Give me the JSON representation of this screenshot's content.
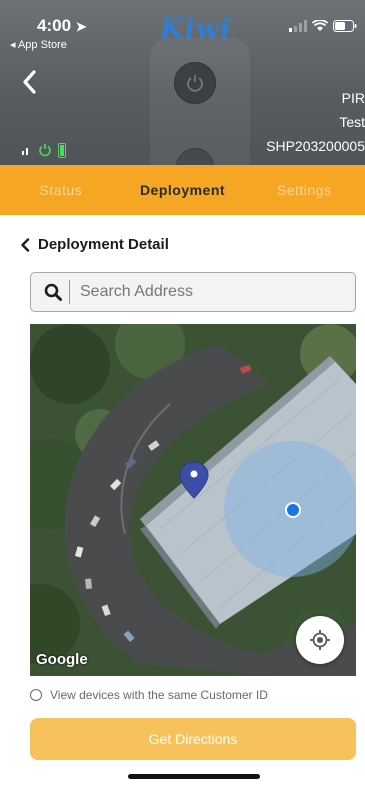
{
  "status_bar": {
    "time": "4:00",
    "back_app_label": "◂ App Store",
    "icons": [
      "cellular-signal-icon",
      "wifi-icon",
      "battery-icon"
    ]
  },
  "header": {
    "brand_logo": "Kiwi",
    "device_name": "PIR",
    "device_label": "Test",
    "serial": "SHP203200005",
    "icons": [
      "back-chevron-icon",
      "power-icon",
      "signal-icon",
      "power-status-icon",
      "battery-level-icon"
    ]
  },
  "tabs": [
    {
      "label": "Status",
      "active": false
    },
    {
      "label": "Deployment",
      "active": true
    },
    {
      "label": "Settings",
      "active": false
    }
  ],
  "page": {
    "title": "Deployment Detail"
  },
  "search": {
    "placeholder": "Search Address",
    "value": ""
  },
  "map": {
    "attribution": "Google",
    "marker_icon": "location-pin-icon",
    "current_location_icon": "blue-dot-icon",
    "locate_button_icon": "my-location-icon"
  },
  "options": {
    "same_customer_label": "View devices with the same Customer ID",
    "checked": false
  },
  "actions": {
    "directions_label": "Get Directions"
  },
  "colors": {
    "accent": "#f5a623",
    "button": "#f7c25b",
    "logo": "#2f7fd6",
    "location": "#1a73e8",
    "pin": "#3b4fa8"
  }
}
